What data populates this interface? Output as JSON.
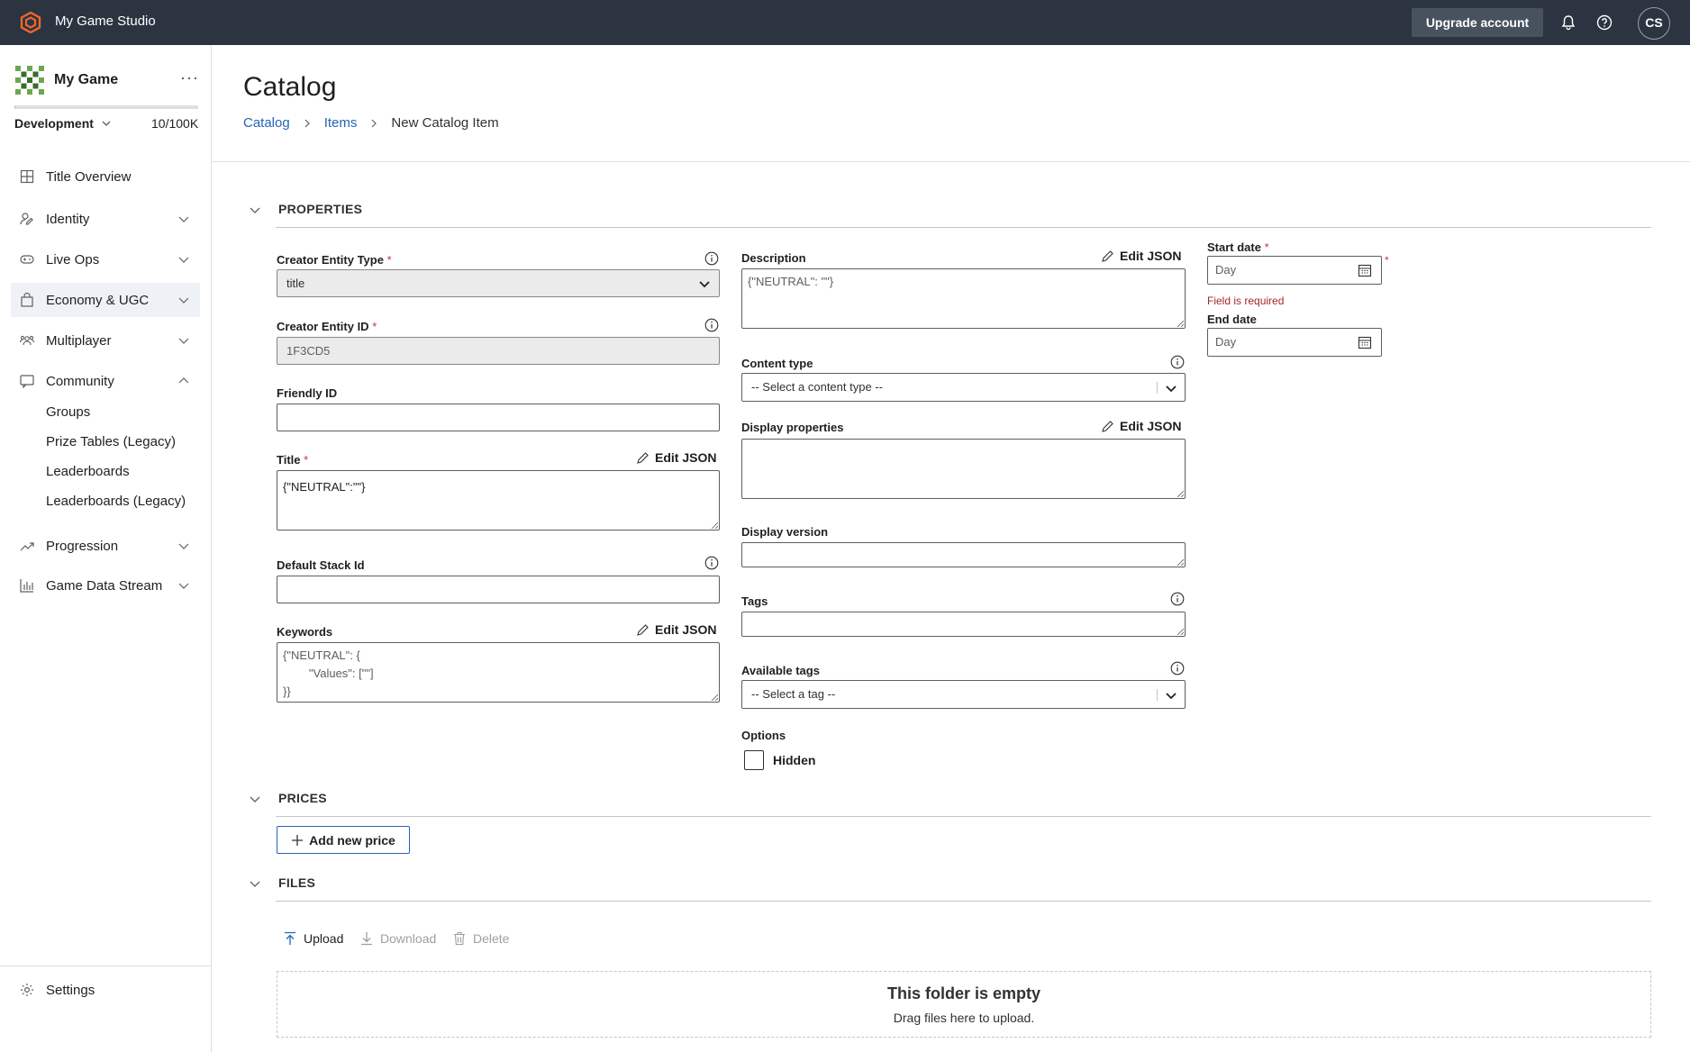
{
  "topbar": {
    "studio_name": "My Game Studio",
    "upgrade_label": "Upgrade account",
    "avatar_initials": "CS",
    "icons": [
      "playfab-logo-icon",
      "bell-icon",
      "help-icon"
    ]
  },
  "sidebar": {
    "game_name": "My Game",
    "more_label": "···",
    "environment": "Development",
    "usage": "10/100K",
    "usage_fraction": 0.0001,
    "nav": [
      {
        "label": "Title Overview",
        "icon": "grid-icon"
      },
      {
        "label": "Identity",
        "icon": "identity-icon"
      },
      {
        "label": "Live Ops",
        "icon": "gamepad-icon"
      },
      {
        "label": "Economy & UGC",
        "icon": "shopping-bag-icon"
      },
      {
        "label": "Multiplayer",
        "icon": "people-icon"
      },
      {
        "label": "Community",
        "icon": "community-icon"
      },
      {
        "label": "Progression",
        "icon": "trend-icon"
      },
      {
        "label": "Game Data Stream",
        "icon": "bar-chart-icon"
      }
    ],
    "community_sub": [
      "Groups",
      "Prize Tables (Legacy)",
      "Leaderboards",
      "Leaderboards (Legacy)"
    ],
    "settings_label": "Settings"
  },
  "header": {
    "title": "Catalog",
    "breadcrumb": [
      "Catalog",
      "Items",
      "New Catalog Item"
    ]
  },
  "sections": {
    "properties": "PROPERTIES",
    "prices": "PRICES",
    "files": "FILES"
  },
  "form": {
    "edit_json": "Edit JSON",
    "creator_entity_type": {
      "label": "Creator Entity Type",
      "value": "title"
    },
    "creator_entity_id": {
      "label": "Creator Entity ID",
      "value": "1F3CD5"
    },
    "friendly_id": {
      "label": "Friendly ID",
      "value": ""
    },
    "title": {
      "label": "Title",
      "value": "{\"NEUTRAL\":\"\"}"
    },
    "default_stack_id": {
      "label": "Default Stack Id",
      "value": ""
    },
    "keywords": {
      "label": "Keywords",
      "value": "{\"NEUTRAL\": {\n        \"Values\": [\"\"]\n}}"
    },
    "description": {
      "label": "Description",
      "value": "{\"NEUTRAL\": \"\"}"
    },
    "content_type": {
      "label": "Content type",
      "placeholder": "-- Select a content type --"
    },
    "display_properties": {
      "label": "Display properties",
      "value": ""
    },
    "display_version": {
      "label": "Display version",
      "value": ""
    },
    "tags": {
      "label": "Tags",
      "value": ""
    },
    "available_tags": {
      "label": "Available tags",
      "placeholder": "-- Select a tag --"
    },
    "options": {
      "label": "Options",
      "hidden_label": "Hidden",
      "hidden_checked": false
    },
    "start_date": {
      "label": "Start date",
      "placeholder": "Day",
      "error": "Field is required"
    },
    "end_date": {
      "label": "End date",
      "placeholder": "Day"
    },
    "required_mark": "*"
  },
  "prices": {
    "add_label": "Add new price"
  },
  "files": {
    "upload": "Upload",
    "download": "Download",
    "delete": "Delete",
    "empty_title": "This folder is empty",
    "empty_sub": "Drag files here to upload."
  }
}
